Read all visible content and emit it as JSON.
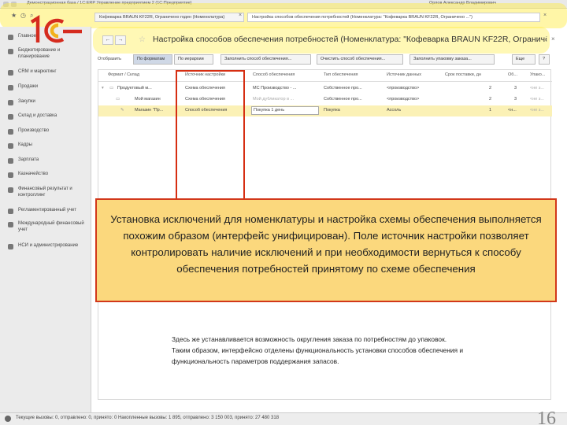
{
  "window": {
    "title": "Демонстрационная база / 1С:ERP Управление предприятием 2  (1С:Предприятие)",
    "user": "Орлов Александр Владимирович"
  },
  "tabs": [
    {
      "label": "Кофеварка BRAUN KF22R, Ограничено годен (Номенклатура)"
    },
    {
      "label": "Настройка способов обеспечения потребностей (Номенклатура: \"Кофеварка BRAUN KF22R, Ограничено ...\")"
    }
  ],
  "sidebar": {
    "items": [
      {
        "label": "Главное",
        "icon": "menu-icon"
      },
      {
        "label": "Бюджетирование и планирование",
        "icon": "chart-icon"
      },
      {
        "label": "CRM и маркетинг",
        "icon": "crm-icon"
      },
      {
        "label": "Продажи",
        "icon": "percent-icon"
      },
      {
        "label": "Закупки",
        "icon": "cart-icon"
      },
      {
        "label": "Склад и доставка",
        "icon": "warehouse-icon"
      },
      {
        "label": "Производство",
        "icon": "factory-icon"
      },
      {
        "label": "Кадры",
        "icon": "people-icon"
      },
      {
        "label": "Зарплата",
        "icon": "money-icon"
      },
      {
        "label": "Казначейство",
        "icon": "bank-icon"
      },
      {
        "label": "Финансовый результат и контроллинг",
        "icon": "finance-icon"
      },
      {
        "label": "Регламентированный учет",
        "icon": "report-icon"
      },
      {
        "label": "Международный финансовый учет",
        "icon": "globe-icon"
      },
      {
        "label": "НСИ и администрирование",
        "icon": "gear-icon"
      }
    ]
  },
  "form": {
    "title": "Настройка способов обеспечения потребностей (Номенклатура: \"Кофеварка BRAUN KF22R, Ограниченно ...",
    "nav_back": "←",
    "nav_forward": "→",
    "star": "☆"
  },
  "actions": {
    "expand": "Отобразить",
    "by_formats": "По форматам",
    "by_hierarchy": "По иерархии",
    "fill_methods": "Заполнить способ обеспечения...",
    "clear_methods": "Очистить способ обеспечения...",
    "fill_package": "Заполнить упаковку заказа...",
    "more": "Еще",
    "help": "?"
  },
  "table": {
    "columns": [
      "Формат / Склад",
      "Источник настройки",
      "Способ обеспечения",
      "Тип обеспечения",
      "Источник данных",
      "Срок поставки, дн",
      "Об...",
      "Упако..."
    ],
    "rows": [
      {
        "name": "Продуктовый м...",
        "source": "Схема обеспечения",
        "method": "МС Производство - ...",
        "type": "Собственное про...",
        "data": "<производство>",
        "days": "2",
        "ob": "3",
        "pack": "<не з...",
        "grey_method": false,
        "selected": false
      },
      {
        "name": "Мой магазин",
        "source": "Схема обеспечения",
        "method": "Мой дубликатор в ...",
        "type": "Собственное про...",
        "data": "<производство>",
        "days": "2",
        "ob": "3",
        "pack": "<не з...",
        "grey_method": true,
        "selected": false
      },
      {
        "name": "Магазин \"Пр...",
        "source": "Способ обеспечения",
        "method": "Покупка 1 день",
        "type": "Покупка",
        "data": "Ассоль",
        "days": "1",
        "ob": "<н...",
        "pack": "<не з...",
        "grey_method": false,
        "selected": true
      }
    ]
  },
  "overlay": {
    "text": "Установка исключений для номенклатуры и настройка схемы обеспечения выполняется похожим образом (интерфейс унифицирован). Поле источник настройки позволяет контролировать  наличие исключений и при необходимости вернуться к способу обеспечения потребностей принятому по схеме обеспечения"
  },
  "note": {
    "line1": "Здесь же устанавливается возможность округления заказа по потребностям до упаковок.",
    "line2": "Таким образом, интерфейсно отделены функциональность установки способов обеспечения и",
    "line3": "функциональность параметров поддержания запасов."
  },
  "status": {
    "text": "Текущие вызовы: 0, отправлено: 0, принято: 0    Накопленные вызовы: 1 895, отправлено: 3 150 003, принято: 27 480 318"
  },
  "slide_number": "16",
  "colors": {
    "highlight": "#ffec3c",
    "annotation_border": "#d62e12",
    "overlay_fill": "#fbd87d",
    "logo_red": "#d52b1e",
    "selected_row": "#fbf1b6"
  }
}
